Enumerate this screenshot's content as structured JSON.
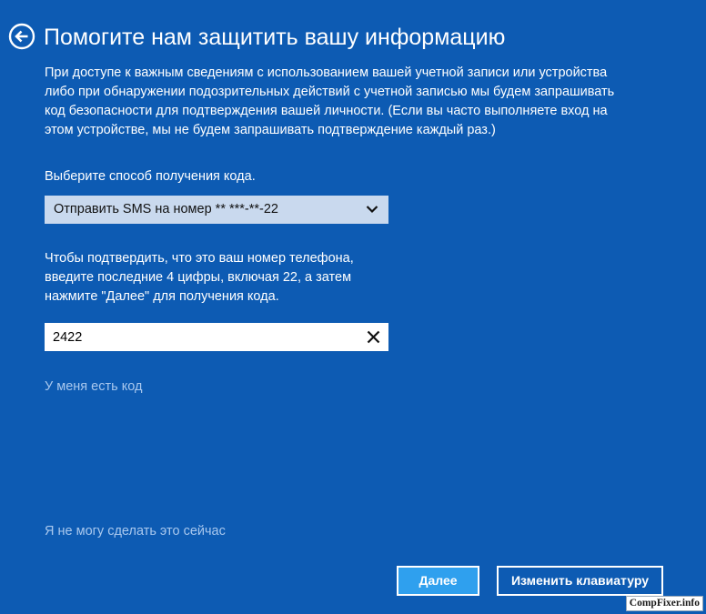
{
  "page": {
    "title": "Помогите нам защитить вашу информацию",
    "back_icon": "back-arrow-circle-icon"
  },
  "intro": {
    "lines": [
      "При доступе к важным сведениям с использованием вашей учетной записи или устройства",
      "либо при обнаружении подозрительных действий с учетной записью мы будем запрашивать",
      "код безопасности для подтверждения вашей личности. (Если вы часто выполняете вход на",
      "этом устройстве, мы не будем запрашивать подтверждение каждый раз.)"
    ]
  },
  "method": {
    "label": "Выберите способ получения кода.",
    "selected": "Отправить SMS на номер ** ***-**-22",
    "icon": "chevron-down-icon"
  },
  "confirm": {
    "lines": [
      "Чтобы подтвердить, что это ваш номер телефона,",
      "введите последние 4 цифры, включая 22, а затем",
      "нажмите \"Далее\" для получения кода."
    ],
    "input_value": "2422",
    "clear_icon": "close-icon"
  },
  "links": {
    "have_code": "У меня есть код",
    "cant_now": "Я не могу сделать это сейчас"
  },
  "buttons": {
    "next": "Далее",
    "change_keyboard": "Изменить клавиатуру"
  },
  "watermark": {
    "text": "CompFixer.info"
  },
  "colors": {
    "background": "#0d5bb3",
    "select_bg": "#c9d9ee",
    "link": "#a9c8ee",
    "primary_button": "#2fa0ee"
  }
}
